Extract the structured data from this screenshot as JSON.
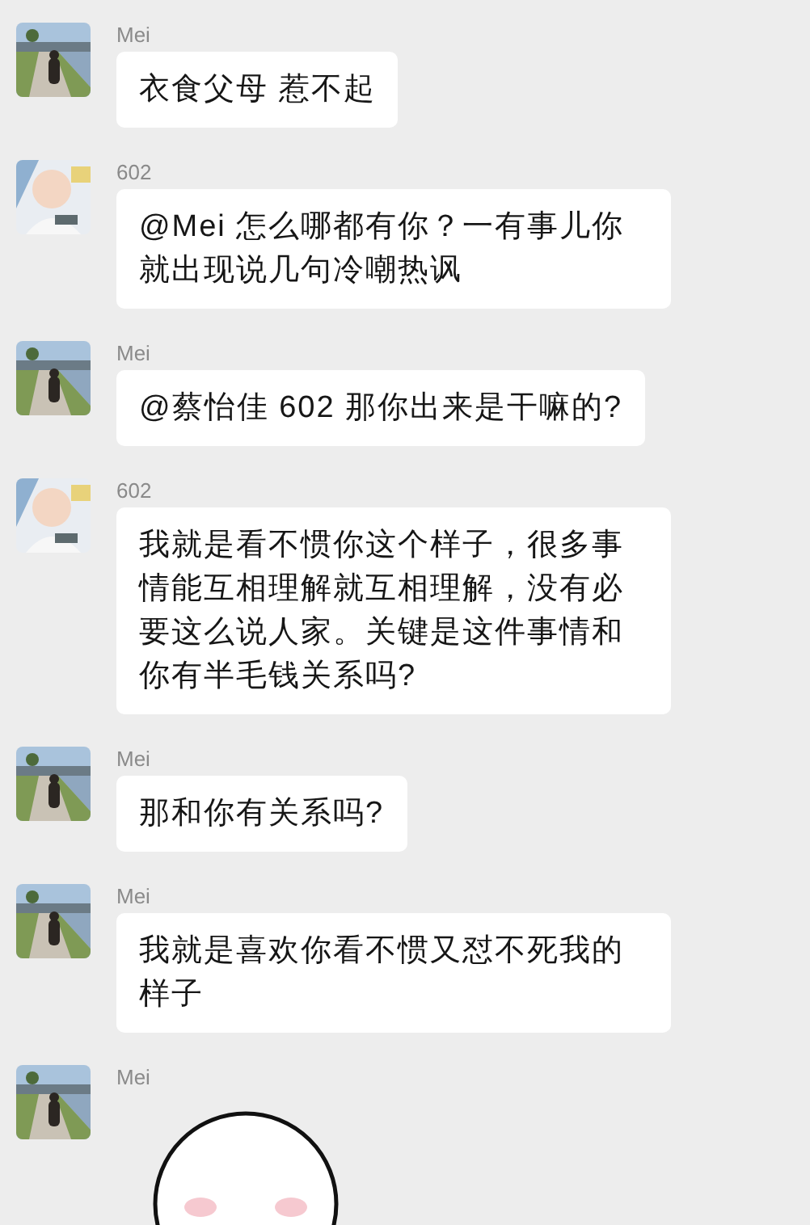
{
  "messages": [
    {
      "sender": "Mei",
      "kind": "text",
      "text": "衣食父母 惹不起"
    },
    {
      "sender": "602",
      "kind": "text",
      "text": "@Mei 怎么哪都有你？一有事儿你就出现说几句冷嘲热讽"
    },
    {
      "sender": "Mei",
      "kind": "text",
      "text": "@蔡怡佳 602 那你出来是干嘛的?"
    },
    {
      "sender": "602",
      "kind": "text",
      "text": "我就是看不惯你这个样子，很多事情能互相理解就互相理解，没有必要这么说人家。关键是这件事情和你有半毛钱关系吗?"
    },
    {
      "sender": "Mei",
      "kind": "text",
      "text": "那和你有关系吗?"
    },
    {
      "sender": "Mei",
      "kind": "text",
      "text": "我就是喜欢你看不惯又怼不死我的样子"
    },
    {
      "sender": "Mei",
      "kind": "sticker"
    }
  ]
}
